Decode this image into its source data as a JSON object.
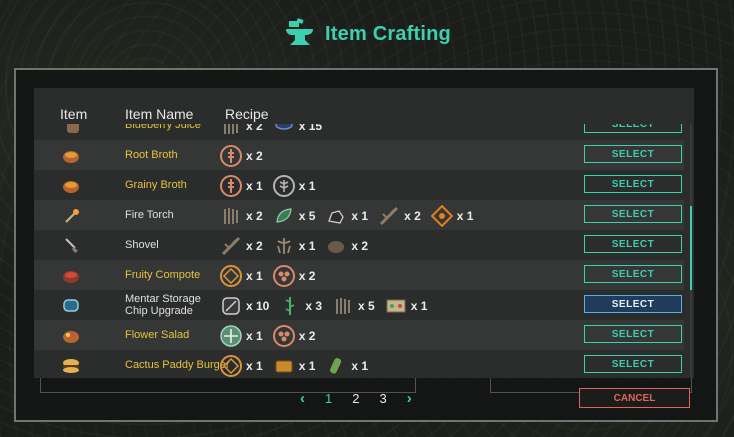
{
  "title": "Item Crafting",
  "table": {
    "headers": {
      "item": "Item",
      "name": "Item Name",
      "recipe": "Recipe"
    },
    "rows": [
      {
        "name": "Blueberry Juice",
        "name_color": "yellow",
        "item_icon": "juice-icon",
        "ingredients": [
          {
            "icon": "fiber-icon",
            "qty": "x 2"
          },
          {
            "icon": "blueberry-icon",
            "qty": "x 15"
          }
        ],
        "select": "SELECT"
      },
      {
        "name": "Root Broth",
        "name_color": "yellow",
        "item_icon": "broth-icon",
        "ingredients": [
          {
            "icon": "root-token-icon",
            "qty": "x 2"
          }
        ],
        "select": "SELECT"
      },
      {
        "name": "Grainy Broth",
        "name_color": "yellow",
        "item_icon": "broth-icon",
        "ingredients": [
          {
            "icon": "root-token-icon",
            "qty": "x 1"
          },
          {
            "icon": "grain-token-icon",
            "qty": "x 1"
          }
        ],
        "select": "SELECT"
      },
      {
        "name": "Fire Torch",
        "name_color": "white",
        "item_icon": "torch-icon",
        "ingredients": [
          {
            "icon": "fiber-icon",
            "qty": "x 2"
          },
          {
            "icon": "leaf-icon",
            "qty": "x 5"
          },
          {
            "icon": "stone-icon",
            "qty": "x 1"
          },
          {
            "icon": "stick-icon",
            "qty": "x 2"
          },
          {
            "icon": "fire-token-icon",
            "qty": "x 1"
          }
        ],
        "select": "SELECT"
      },
      {
        "name": "Shovel",
        "name_color": "white",
        "item_icon": "shovel-icon",
        "ingredients": [
          {
            "icon": "stick-icon",
            "qty": "x 2"
          },
          {
            "icon": "root-fiber-icon",
            "qty": "x 1"
          },
          {
            "icon": "rock-icon",
            "qty": "x 2"
          }
        ],
        "select": "SELECT"
      },
      {
        "name": "Fruity Compote",
        "name_color": "yellow",
        "item_icon": "compote-icon",
        "ingredients": [
          {
            "icon": "fruit-token-icon",
            "qty": "x 1"
          },
          {
            "icon": "berry-token-icon",
            "qty": "x 2"
          }
        ],
        "select": "SELECT"
      },
      {
        "name": "Mentar Storage Chip Upgrade",
        "name_color": "white",
        "item_icon": "chip-icon",
        "ingredients": [
          {
            "icon": "plate-icon",
            "qty": "x 10"
          },
          {
            "icon": "vine-icon",
            "qty": "x 3"
          },
          {
            "icon": "fiber-icon",
            "qty": "x 5"
          },
          {
            "icon": "board-icon",
            "qty": "x 1"
          }
        ],
        "select": "SELECT",
        "active": true
      },
      {
        "name": "Flower Salad",
        "name_color": "yellow",
        "item_icon": "salad-icon",
        "ingredients": [
          {
            "icon": "flower-token-icon",
            "qty": "x 1"
          },
          {
            "icon": "berry-token-icon",
            "qty": "x 2"
          }
        ],
        "select": "SELECT"
      },
      {
        "name": "Cactus Paddy Burger",
        "name_color": "yellow",
        "item_icon": "burger-icon",
        "ingredients": [
          {
            "icon": "fruit-token-icon",
            "qty": "x 1"
          },
          {
            "icon": "bread-icon",
            "qty": "x 1"
          },
          {
            "icon": "cactus-icon",
            "qty": "x 1"
          }
        ],
        "select": "SELECT"
      }
    ]
  },
  "pagination": {
    "prev": "‹",
    "pages": [
      "1",
      "2",
      "3"
    ],
    "current": "1",
    "next": "›"
  },
  "cancel_label": "CANCEL",
  "colors": {
    "accent": "#3ccfb0",
    "yellow_name": "#e7c33e",
    "cancel": "#e0655c",
    "active_select": "#1f3c5c"
  }
}
